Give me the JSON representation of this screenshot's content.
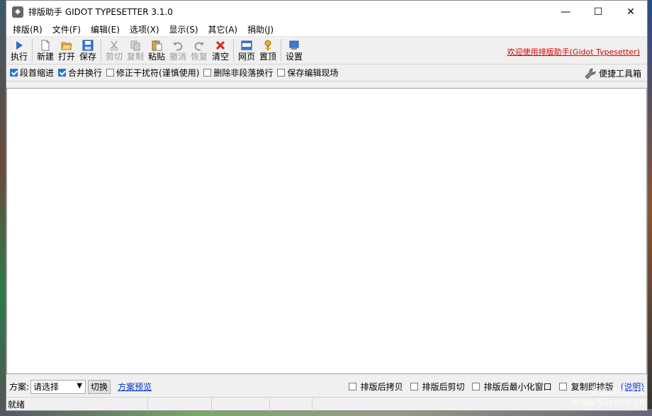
{
  "window": {
    "title": "排版助手 GIDOT TYPESETTER 3.1.0",
    "minimize": "—",
    "maximize": "☐",
    "close": "✕"
  },
  "menu": [
    "排版(R)",
    "文件(F)",
    "编辑(E)",
    "选项(X)",
    "显示(S)",
    "其它(A)",
    "捐助(J)"
  ],
  "toolbar": {
    "run": "执行",
    "new": "新建",
    "open": "打开",
    "save": "保存",
    "cut": "剪切",
    "copy": "复制",
    "paste": "粘贴",
    "undo": "撤消",
    "redo": "恢复",
    "clear": "清空",
    "web": "网页",
    "top": "置顶",
    "settings": "设置",
    "welcome": "欢迎使用排版助手(Gidot Typesetter)"
  },
  "options": [
    {
      "label": "段首缩进",
      "checked": true
    },
    {
      "label": "合并换行",
      "checked": true
    },
    {
      "label": "修正干扰符(谨慎使用)",
      "checked": false
    },
    {
      "label": "删除非段落换行",
      "checked": false
    },
    {
      "label": "保存编辑现场",
      "checked": false
    }
  ],
  "toolbox_label": "便捷工具箱",
  "scheme": {
    "label": "方案:",
    "selected": "请选择",
    "switch_button": "切换",
    "preview_link": "方案预览"
  },
  "after_options": [
    {
      "label": "排版后拷贝",
      "checked": false
    },
    {
      "label": "排版后剪切",
      "checked": false
    },
    {
      "label": "排版后最小化窗口",
      "checked": false
    },
    {
      "label": "复制即排版",
      "checked": false
    }
  ],
  "help_link": "(说明)",
  "status": {
    "text": "就绪"
  },
  "watermark": {
    "line1": "吾爱破解论坛",
    "line2": "www.52pojie.cn"
  },
  "colors": {
    "welcome": "#d80000",
    "link": "#0033cc",
    "check": "#2d75d6"
  }
}
